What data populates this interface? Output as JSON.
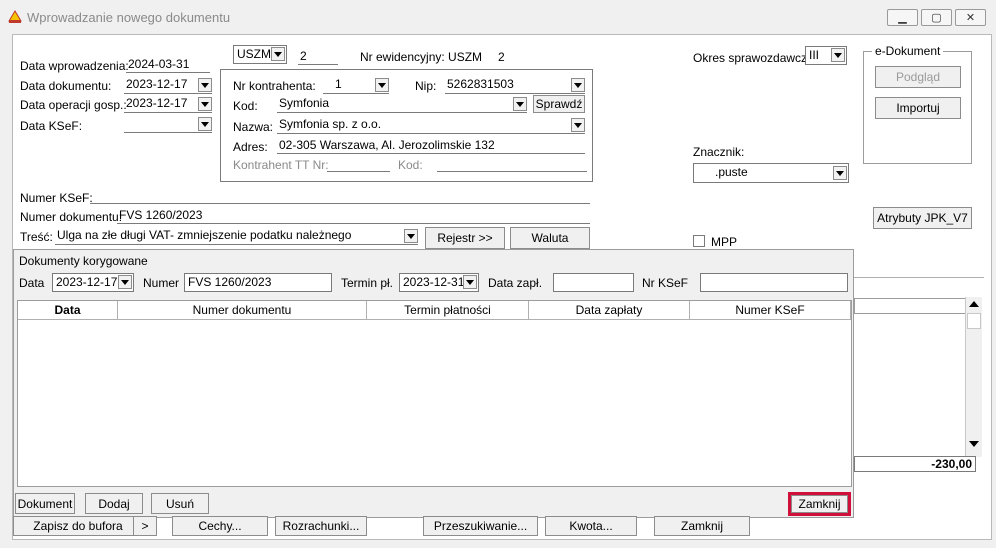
{
  "window": {
    "title": "Wprowadzanie nowego dokumentu",
    "minimize": "▁",
    "maximize": "▢",
    "close": "✕"
  },
  "dates": {
    "wprowadzenia_label": "Data wprowadzenia:",
    "wprowadzenia_value": "2024-03-31",
    "dokumentu_label": "Data dokumentu:",
    "dokumentu_value": "2023-12-17",
    "operacji_label": "Data operacji gosp.:",
    "operacji_value": "2023-12-17",
    "ksef_label": "Data KSeF:",
    "ksef_value": ""
  },
  "register": {
    "code": "USZM",
    "number": "2",
    "nr_ewid_label": "Nr ewidencyjny: USZM",
    "nr_ewid_value": "2"
  },
  "contractor": {
    "nr_label": "Nr kontrahenta:",
    "nr_value": "1",
    "nip_label": "Nip:",
    "nip_value": "5262831503",
    "kod_label": "Kod:",
    "kod_value": "Symfonia",
    "sprawdz": "Sprawdź",
    "nazwa_label": "Nazwa:",
    "nazwa_value": "Symfonia sp. z o.o.",
    "adres_label": "Adres:",
    "adres_value": "02-305 Warszawa, Al. Jerozolimskie 132",
    "tt_label": "Kontrahent TT Nr:",
    "tt_kod_label": "Kod:"
  },
  "right": {
    "okres_label": "Okres sprawozdawczy:",
    "okres_value": "III",
    "edok_title": "e-Dokument",
    "podglad": "Podgląd",
    "importuj": "Importuj",
    "znacznik_label": "Znacznik:",
    "znacznik_value": ".puste",
    "atrybuty": "Atrybuty JPK_V7",
    "mpp_label": "MPP",
    "amount": "-230,00"
  },
  "doc": {
    "ksef_label": "Numer KSeF:",
    "ksef_value": "",
    "numer_label": "Numer dokumentu:",
    "numer_value": "FVS 1260/2023",
    "tresc_label": "Treść:",
    "tresc_value": "Ulga na złe długi VAT- zmniejszenie podatku należnego",
    "rejestr": "Rejestr >>",
    "waluta": "Waluta"
  },
  "corrected": {
    "title": "Dokumenty korygowane",
    "data_label": "Data",
    "data_value": "2023-12-17",
    "numer_label": "Numer",
    "numer_value": "FVS 1260/2023",
    "termin_label": "Termin pł.",
    "termin_value": "2023-12-31",
    "data_zapl_label": "Data zapł.",
    "data_zapl_value": "",
    "nr_ksef_label": "Nr KSeF",
    "nr_ksef_value": "",
    "columns": [
      "Data",
      "Numer dokumentu",
      "Termin płatności",
      "Data zapłaty",
      "Numer KSeF"
    ],
    "btn_dokument": "Dokument",
    "btn_dodaj": "Dodaj",
    "btn_usun": "Usuń",
    "btn_zamknij": "Zamknij",
    "highlight_color": "#d0103a"
  },
  "bottom": {
    "zapisz": "Zapisz do bufora",
    "more": ">",
    "cechy": "Cechy...",
    "rozrachunki": "Rozrachunki...",
    "przeszukiwanie": "Przeszukiwanie...",
    "kwota": "Kwota...",
    "zamknij": "Zamknij"
  }
}
